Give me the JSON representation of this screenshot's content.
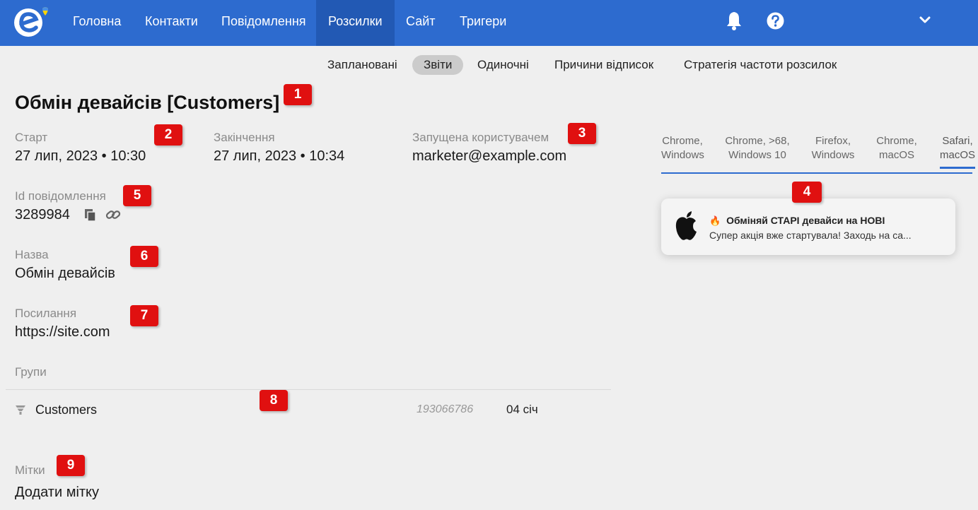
{
  "header": {
    "nav": [
      "Головна",
      "Контакти",
      "Повідомлення",
      "Розсилки",
      "Сайт",
      "Тригери"
    ],
    "active_nav": "Розсилки",
    "icons": [
      "bell-icon",
      "help-icon",
      "chevron-down-icon"
    ],
    "brand_color": "#2d6bcf"
  },
  "subnav": {
    "items": [
      "Заплановані",
      "Звіти",
      "Одиночні",
      "Причини відписок",
      "Стратегія частоти розсилок"
    ],
    "active": "Звіти"
  },
  "page": {
    "title": "Обмін девайсів [Customers]",
    "start_label": "Старт",
    "start_value": "27 лип, 2023 • 10:30",
    "end_label": "Закінчення",
    "end_value": "27 лип, 2023 • 10:34",
    "launched_label": "Запущена користувачем",
    "launched_value": "marketer@example.com",
    "message_id_label": "Id повідомлення",
    "message_id_value": "3289984",
    "name_label": "Назва",
    "name_value": "Обмін девайсів",
    "link_label": "Посилання",
    "link_value": "https://site.com",
    "groups_label": "Групи",
    "group_name": "Customers",
    "group_id": "193066786",
    "group_date": "04 січ",
    "tags_label": "Мітки",
    "tags_add": "Додати мітку"
  },
  "preview": {
    "tabs": [
      {
        "line1": "Chrome,",
        "line2": "Windows"
      },
      {
        "line1": "Chrome, >68,",
        "line2": "Windows 10"
      },
      {
        "line1": "Firefox,",
        "line2": "Windows"
      },
      {
        "line1": "Chrome,",
        "line2": "macOS"
      },
      {
        "line1": "Safari,",
        "line2": "macOS"
      }
    ],
    "active_tab": "Safari, macOS",
    "notification_emoji": "🔥",
    "notification_title": "Обміняй СТАРІ девайси на НОВІ",
    "notification_body": "Супер акція вже стартувала! Заходь на са..."
  },
  "badges": [
    "1",
    "2",
    "3",
    "4",
    "5",
    "6",
    "7",
    "8",
    "9"
  ],
  "colors": {
    "accent": "#2d6bcf",
    "badge": "#e01010",
    "background": "#efefef"
  }
}
